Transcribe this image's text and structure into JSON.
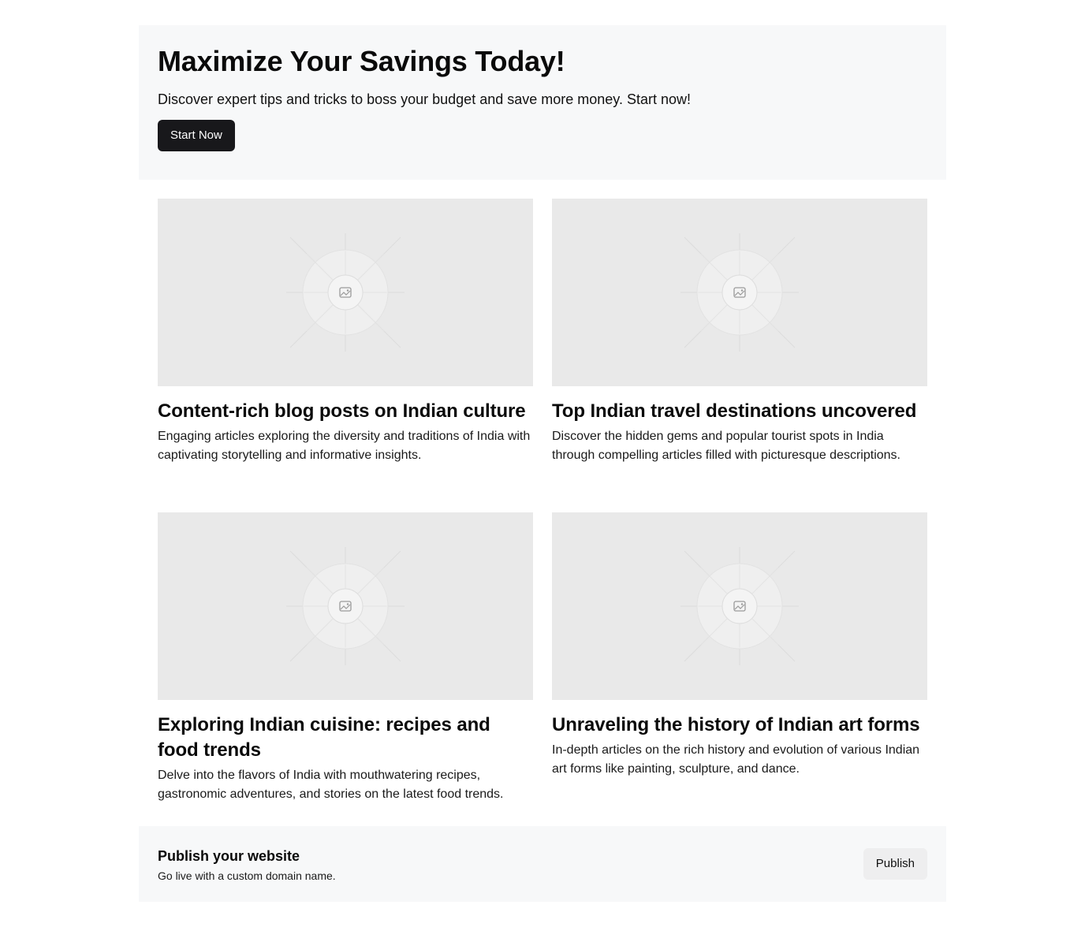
{
  "hero": {
    "title": "Maximize Your Savings Today!",
    "subtitle": "Discover expert tips and tricks to boss your budget and save more money. Start now!",
    "cta_label": "Start Now"
  },
  "cards": [
    {
      "title": "Content-rich blog posts on Indian culture",
      "description": "Engaging articles exploring the diversity and traditions of India with captivating storytelling and informative insights.",
      "image_icon": "image-placeholder-icon"
    },
    {
      "title": "Top Indian travel destinations uncovered",
      "description": "Discover the hidden gems and popular tourist spots in India through compelling articles filled with picturesque descriptions.",
      "image_icon": "image-placeholder-icon"
    },
    {
      "title": "Exploring Indian cuisine: recipes and food trends",
      "description": "Delve into the flavors of India with mouthwatering recipes, gastronomic adventures, and stories on the latest food trends.",
      "image_icon": "image-placeholder-icon"
    },
    {
      "title": "Unraveling the history of Indian art forms",
      "description": "In-depth articles on the rich history and evolution of various Indian art forms like painting, sculpture, and dance.",
      "image_icon": "image-placeholder-icon"
    }
  ],
  "footer": {
    "title": "Publish your website",
    "subtitle": "Go live with a custom domain name.",
    "button_label": "Publish"
  },
  "colors": {
    "primary_button": "#18181b",
    "panel_background": "#f7f8f9",
    "image_placeholder": "#e9e9e9"
  }
}
